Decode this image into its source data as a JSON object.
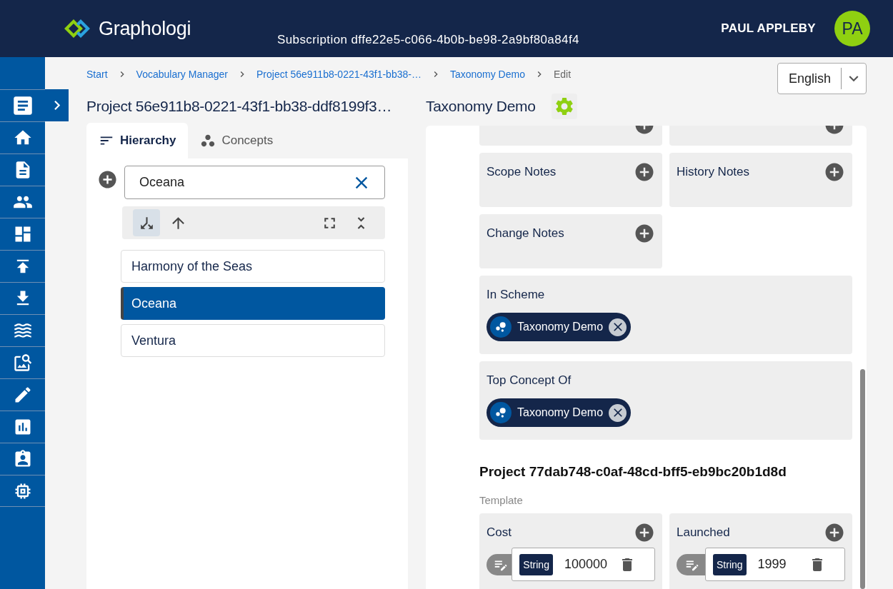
{
  "header": {
    "logo": "Graphologi",
    "subscription": "Subscription dffe22e5-c066-4b0b-be98-2a9bf80a84f4",
    "user": "PAUL APPLEBY",
    "avatar": "PA"
  },
  "sidebar": {
    "items": [
      {
        "kind": "home"
      },
      {
        "kind": "document"
      },
      {
        "kind": "people"
      },
      {
        "kind": "dashboard"
      },
      {
        "kind": "upload"
      },
      {
        "kind": "download"
      },
      {
        "kind": "waves"
      },
      {
        "kind": "search"
      },
      {
        "kind": "edit"
      },
      {
        "kind": "chart"
      },
      {
        "kind": "badge"
      },
      {
        "kind": "chip"
      }
    ]
  },
  "breadcrumb": [
    {
      "label": "Start",
      "kind": "link"
    },
    {
      "label": "Vocabulary Manager",
      "kind": "link"
    },
    {
      "label": "Project 56e911b8-0221-43f1-bb38-…",
      "kind": "link"
    },
    {
      "label": "Taxonomy Demo",
      "kind": "link"
    },
    {
      "label": "Edit",
      "kind": "current"
    }
  ],
  "language": {
    "value": "English"
  },
  "left": {
    "title": "Project 56e911b8-0221-43f1-bb38-ddf8199f3…",
    "tabs": [
      {
        "label": "Hierarchy",
        "selected": true
      },
      {
        "label": "Concepts",
        "selected": false
      }
    ],
    "search": {
      "value": "Oceana"
    },
    "tools": [
      {
        "kind": "split",
        "selected": true
      },
      {
        "kind": "up",
        "selected": false
      }
    ],
    "tree": [
      {
        "label": "Harmony of the Seas",
        "selected": false
      },
      {
        "label": "Oceana",
        "selected": true
      },
      {
        "label": "Ventura",
        "selected": false
      }
    ]
  },
  "right": {
    "title": "Taxonomy Demo",
    "cut_cards": [
      {
        "kind": "note"
      },
      {
        "kind": "note"
      }
    ],
    "note_cards": [
      {
        "label": "Scope Notes"
      },
      {
        "label": "History Notes"
      },
      {
        "label": "Change Notes"
      }
    ],
    "relations": [
      {
        "label": "In Scheme",
        "chips": [
          "Taxonomy Demo"
        ]
      },
      {
        "label": "Top Concept Of",
        "chips": [
          "Taxonomy Demo"
        ]
      }
    ],
    "project": {
      "title": "Project 77dab748-c0af-48cd-bff5-eb9bc20b1d8d",
      "subtitle": "Template",
      "properties": [
        {
          "label": "Cost",
          "type": "String",
          "value": "100000"
        },
        {
          "label": "Launched",
          "type": "String",
          "value": "1999"
        }
      ]
    }
  }
}
